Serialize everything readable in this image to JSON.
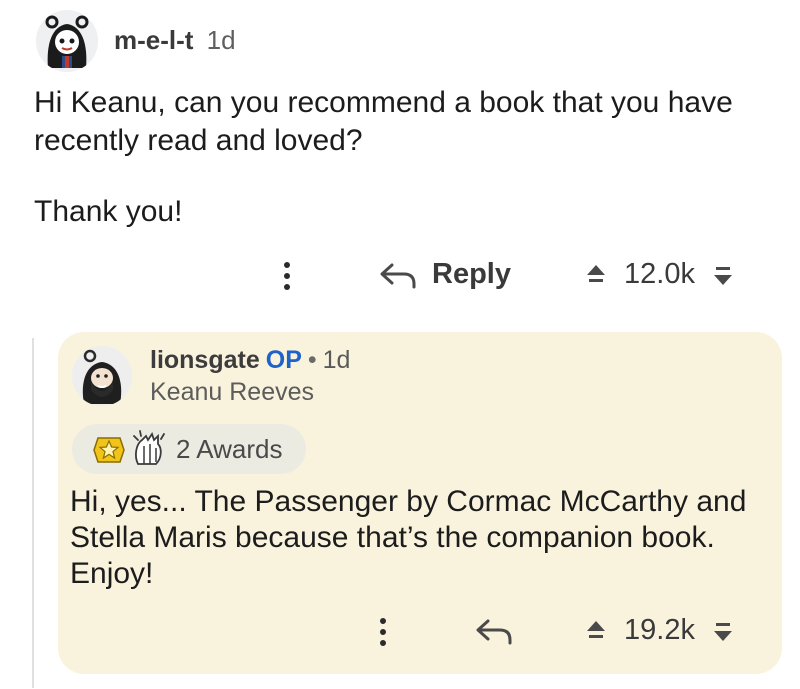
{
  "top_comment": {
    "username": "m-e-l-t",
    "age": "1d",
    "text_line1": "Hi Keanu, can you recommend a book that you have",
    "text_line2": "recently read and loved?",
    "text_line3": "Thank you!",
    "reply_label": "Reply",
    "score": "12.0k",
    "avatar_icon": "anime-character-avatar-icon"
  },
  "reply_comment": {
    "username": "lionsgate",
    "op_badge": "OP",
    "separator": "•",
    "age": "1d",
    "flair": "Keanu Reeves",
    "awards_label": "2 Awards",
    "text_line1": "Hi, yes... The Passenger by Cormac McCarthy and",
    "text_line2": "Stella Maris because that’s the companion book.",
    "text_line3": "Enjoy!",
    "score": "19.2k",
    "avatar_icon": "bearded-man-avatar-icon",
    "card_color": "#f9f3de",
    "op_color": "#1d63c9"
  }
}
